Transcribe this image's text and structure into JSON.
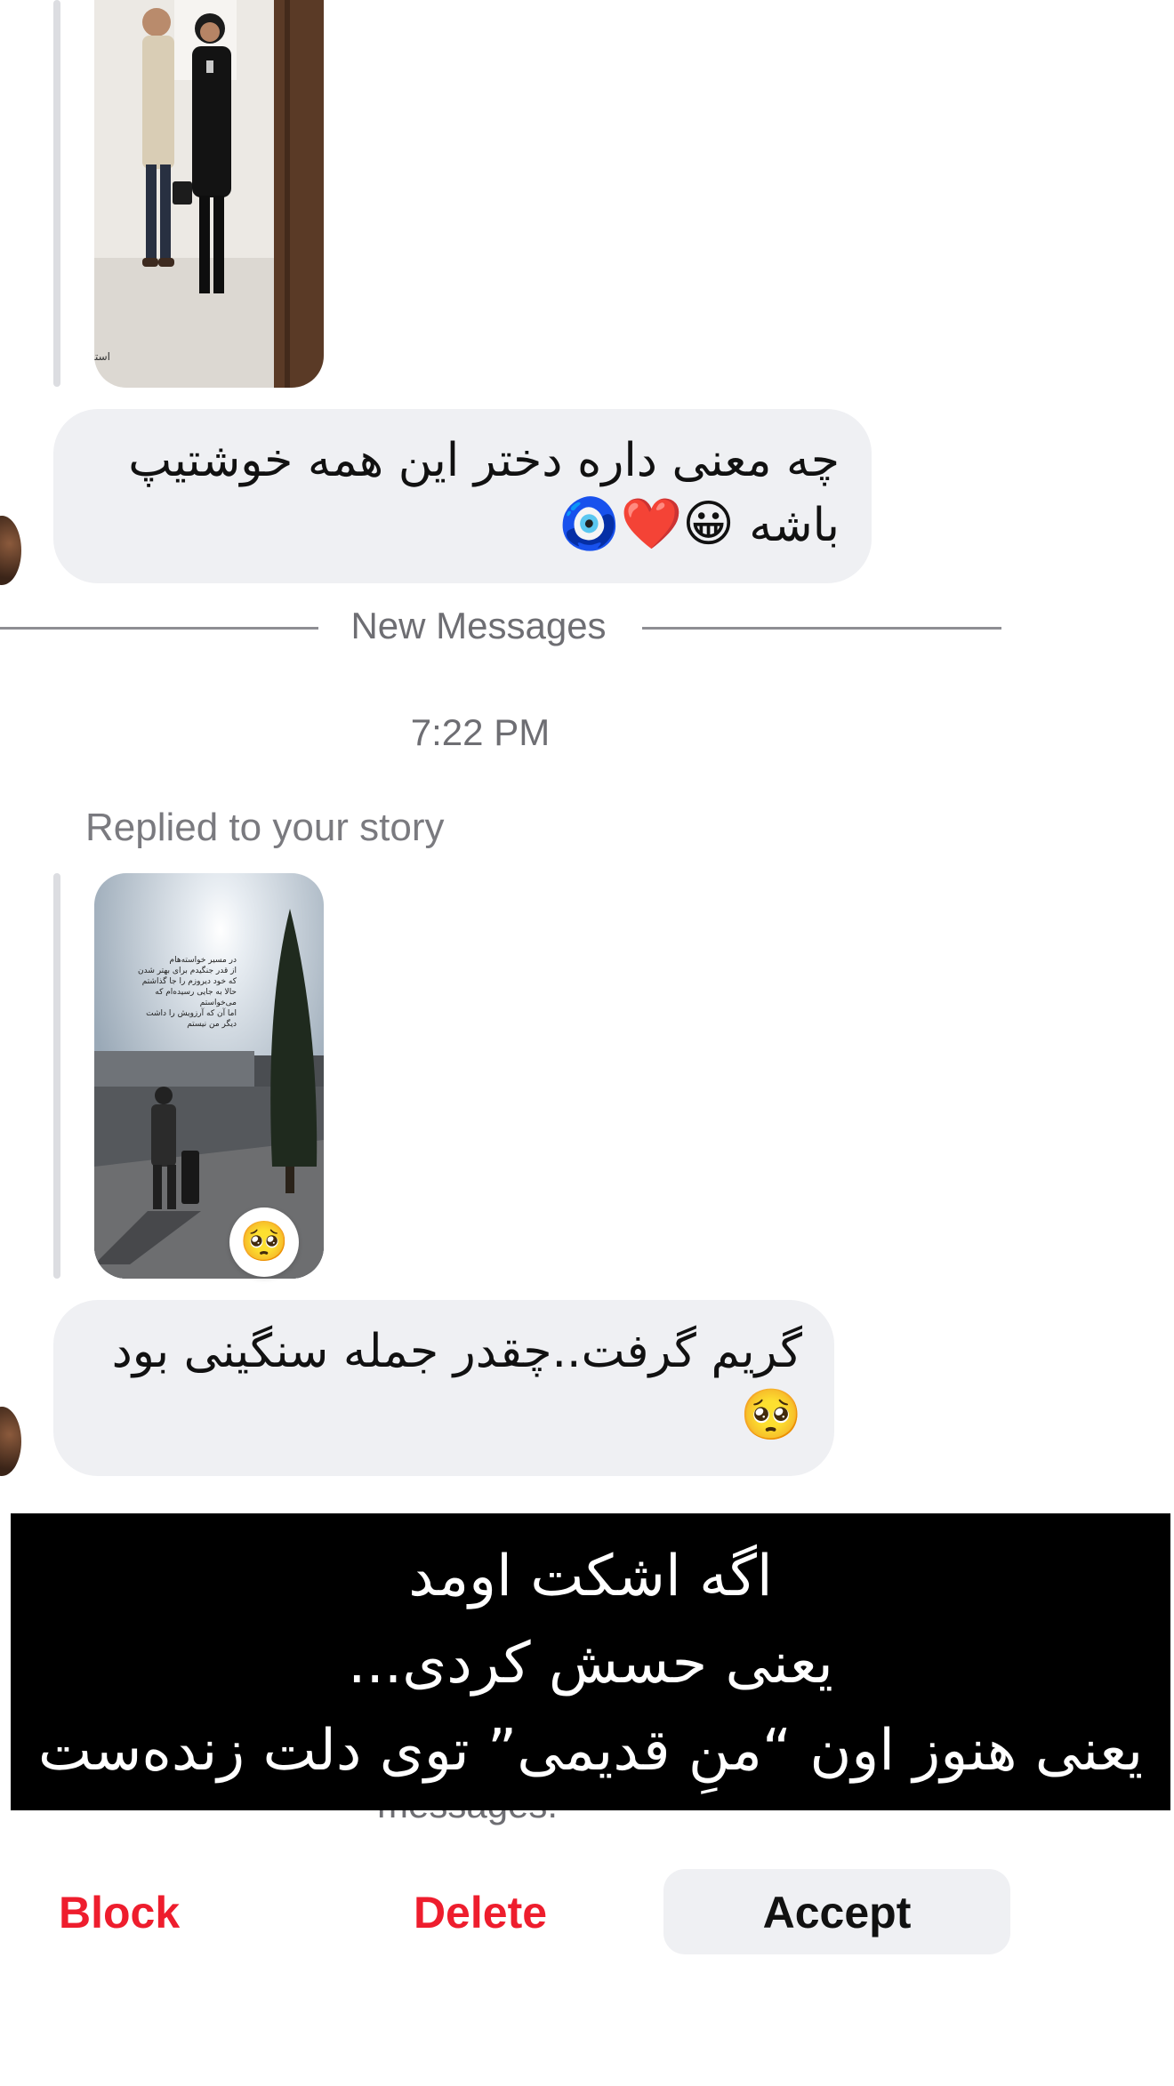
{
  "messages": [
    {
      "type": "story_reply",
      "story_caption": "استایل امشبمون خوبه؟",
      "text": "چه معنی داره دختر این همه خوشتیپ باشه",
      "emojis": "😀❤️🧿"
    },
    {
      "type": "story_reply",
      "story_text": "در مسیر خواسته‌هام\nاز قدر جنگیدم برای بهتر شدن\nکه خود دیروزم را جا گذاشتم\nحالا به جایی رسیده‌ام که\nمی‌خواستم\nاما آن که آرزویش را داشت\nدیگر من نیستم",
      "reaction": "🥺",
      "text": "گریم گرفت..چقدر جمله سنگینی بود",
      "emojis": "🥺"
    }
  ],
  "divider": {
    "label": "New Messages"
  },
  "timestamp": "7:22 PM",
  "replied_label": "Replied to your story",
  "under_overlay_text": "messages.",
  "overlay": {
    "lines": [
      "اگه اشکت اومد",
      "یعنی حسش کردی...",
      "یعنی هنوز اون “منِ قدیمی” توی دلت زنده‌ست"
    ]
  },
  "actions": {
    "block": "Block",
    "delete": "Delete",
    "accept": "Accept"
  },
  "colors": {
    "destructive": "#ee1d2d",
    "bubble": "#eff0f3",
    "secondary_text": "#6e6e73"
  }
}
